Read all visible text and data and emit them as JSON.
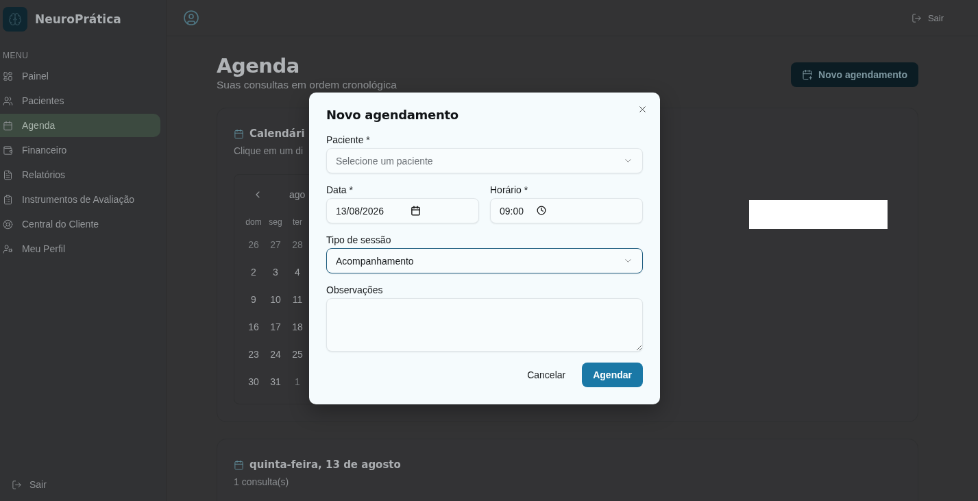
{
  "brand": {
    "name": "NeuroPrática"
  },
  "sidebar": {
    "section_label": "MENU",
    "items": [
      {
        "label": "Painel",
        "kind": "dashboard",
        "selected": false
      },
      {
        "label": "Pacientes",
        "kind": "users",
        "selected": false
      },
      {
        "label": "Agenda",
        "kind": "calendar",
        "selected": true
      },
      {
        "label": "Financeiro",
        "kind": "wallet",
        "selected": false
      },
      {
        "label": "Relatórios",
        "kind": "report",
        "selected": false
      },
      {
        "label": "Instrumentos de Avaliação",
        "kind": "clipboard",
        "selected": false
      },
      {
        "label": "Central do Cliente",
        "kind": "support",
        "selected": false
      },
      {
        "label": "Meu Perfil",
        "kind": "profile",
        "selected": false
      }
    ],
    "logout": "Sair"
  },
  "header": {
    "logout": "Sair"
  },
  "page": {
    "title": "Agenda",
    "subtitle": "Suas consultas em ordem cronológica",
    "new_button": "Novo agendamento"
  },
  "calendar_card": {
    "title": "Calendári",
    "description": "Clique em um di",
    "month": "ago",
    "weekdays": [
      "dom",
      "seg",
      "ter"
    ],
    "weeks": [
      [
        {
          "day": "26",
          "outside": true
        },
        {
          "day": "27",
          "outside": true
        },
        {
          "day": "28",
          "outside": true
        }
      ],
      [
        {
          "day": "2",
          "outside": false
        },
        {
          "day": "3",
          "outside": false
        },
        {
          "day": "4",
          "outside": false
        }
      ],
      [
        {
          "day": "9",
          "outside": false
        },
        {
          "day": "10",
          "outside": false
        },
        {
          "day": "11",
          "outside": false
        }
      ],
      [
        {
          "day": "16",
          "outside": false
        },
        {
          "day": "17",
          "outside": false
        },
        {
          "day": "18",
          "outside": false
        }
      ],
      [
        {
          "day": "23",
          "outside": false
        },
        {
          "day": "24",
          "outside": false
        },
        {
          "day": "25",
          "outside": false
        }
      ],
      [
        {
          "day": "30",
          "outside": false
        },
        {
          "day": "31",
          "outside": false
        },
        {
          "day": "1",
          "outside": true
        }
      ]
    ]
  },
  "day_card": {
    "title": "quinta-feira, 13 de agosto",
    "count": "1 consulta(s)"
  },
  "dialog": {
    "title": "Novo agendamento",
    "rows": [
      [
        {
          "kind": "select",
          "label": "Paciente *",
          "placeholder": "Selecione um paciente",
          "focused": false
        }
      ],
      [
        {
          "kind": "date",
          "label": "Data *",
          "value": "13/08/2026",
          "focused": false
        },
        {
          "kind": "time",
          "label": "Horário *",
          "value": "09:00",
          "focused": false
        }
      ],
      [
        {
          "kind": "select",
          "label": "Tipo de sessão",
          "value": "Acompanhamento",
          "focused": true
        }
      ],
      [
        {
          "kind": "textarea",
          "label": "Observações",
          "focused": false
        }
      ]
    ],
    "cancel": "Cancelar",
    "submit": "Agendar"
  }
}
